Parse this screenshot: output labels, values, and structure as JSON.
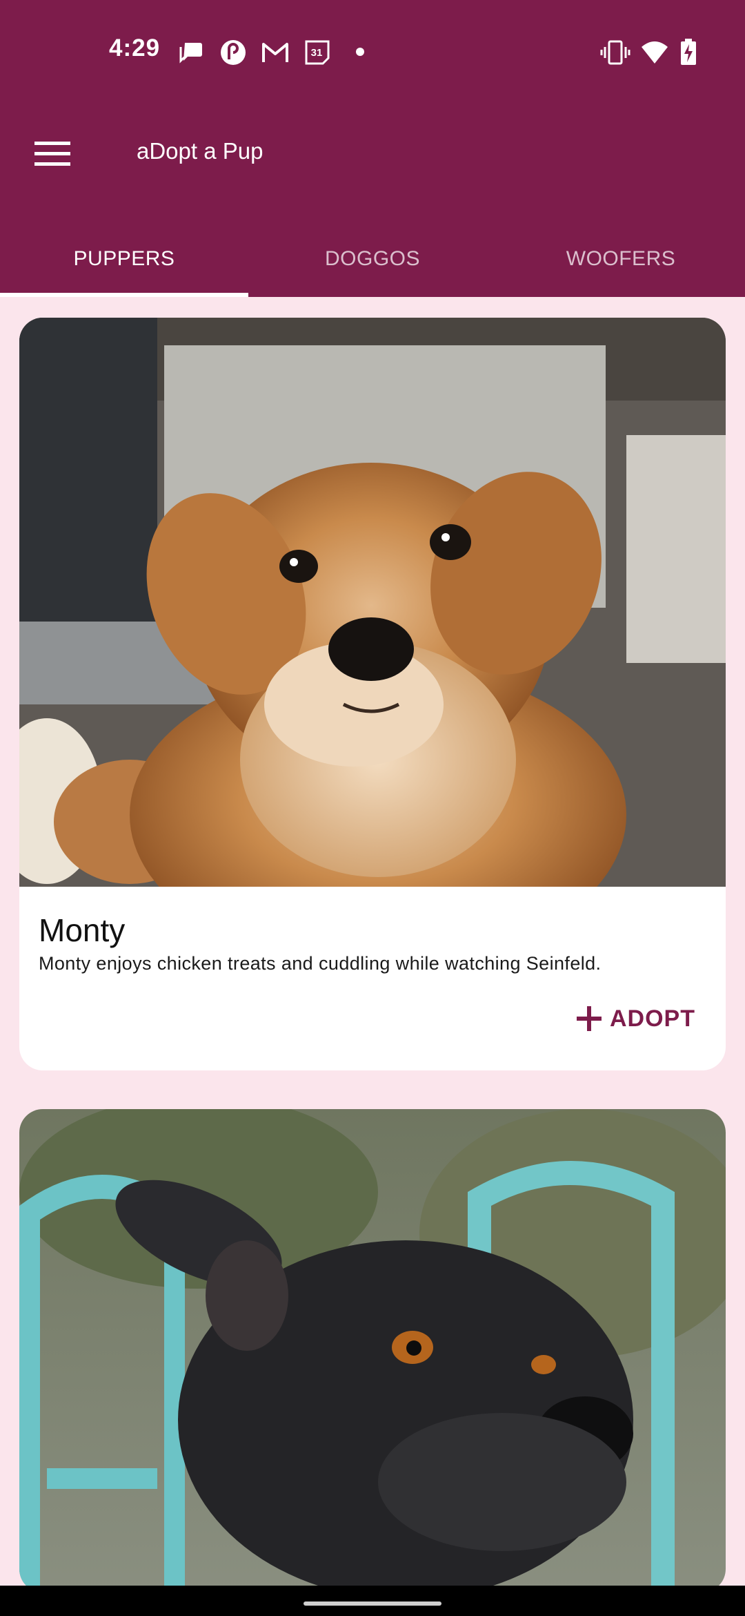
{
  "status_bar": {
    "time": "4:29",
    "notification_icons": [
      "chat-icon",
      "pocket-casts-icon",
      "gmail-icon",
      "calendar-icon",
      "dot-icon"
    ],
    "calendar_day": "31",
    "system_icons": [
      "vibrate-icon",
      "wifi-icon",
      "battery-charging-icon"
    ]
  },
  "app": {
    "title": "aDopt a Pup",
    "menu_icon": "menu-icon",
    "colors": {
      "primary": "#7d1c4b",
      "background": "#fbe5ec",
      "card": "#ffffff"
    }
  },
  "tabs": [
    {
      "label": "PUPPERS",
      "selected": true
    },
    {
      "label": "DOGGOS",
      "selected": false
    },
    {
      "label": "WOOFERS",
      "selected": false
    }
  ],
  "cards": [
    {
      "name": "Monty",
      "description": "Monty enjoys chicken treats and cuddling while watching Seinfeld.",
      "action_label": "ADOPT",
      "action_icon": "plus-icon"
    }
  ]
}
